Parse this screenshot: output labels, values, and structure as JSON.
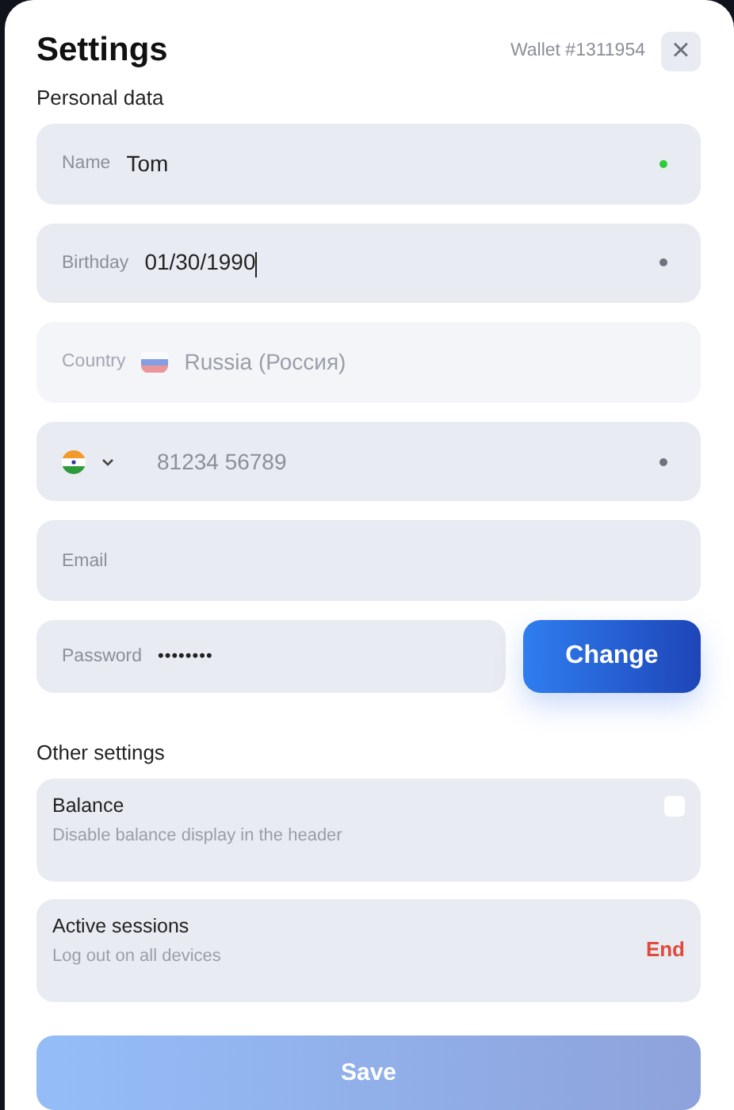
{
  "title": "Settings",
  "wallet": "Wallet #1311954",
  "close": "×",
  "personal_heading": "Personal data",
  "fields": [
    {
      "kind": "text",
      "label": "Name",
      "value": "Tom",
      "color": "#2ecc3a",
      "disabled": false,
      "focused": false
    },
    {
      "kind": "text",
      "label": "Birthday",
      "value": "01/30/1990",
      "color": "#6f7380",
      "disabled": false,
      "focused": true
    },
    {
      "kind": "country",
      "label": "Country",
      "value": "Russia (Россия)",
      "disabled": true,
      "focused": false
    },
    {
      "kind": "phone",
      "placeholder": "81234 56789",
      "color": "#6f7380",
      "disabled": false,
      "focused": false
    },
    {
      "kind": "text",
      "label": "Email",
      "disabled": false,
      "focused": false
    }
  ],
  "password": {
    "label": "Password",
    "value": "••••••••",
    "button": "Change"
  },
  "other_heading": "Other settings",
  "settings": [
    {
      "kind": "checkbox",
      "title": "Balance",
      "description": "Disable balance display in the header",
      "checked": false
    },
    {
      "kind": "action",
      "title": "Active sessions",
      "description": "Log out on all devices",
      "action": "End"
    }
  ],
  "save": {
    "label": "Save",
    "disabled": true
  }
}
